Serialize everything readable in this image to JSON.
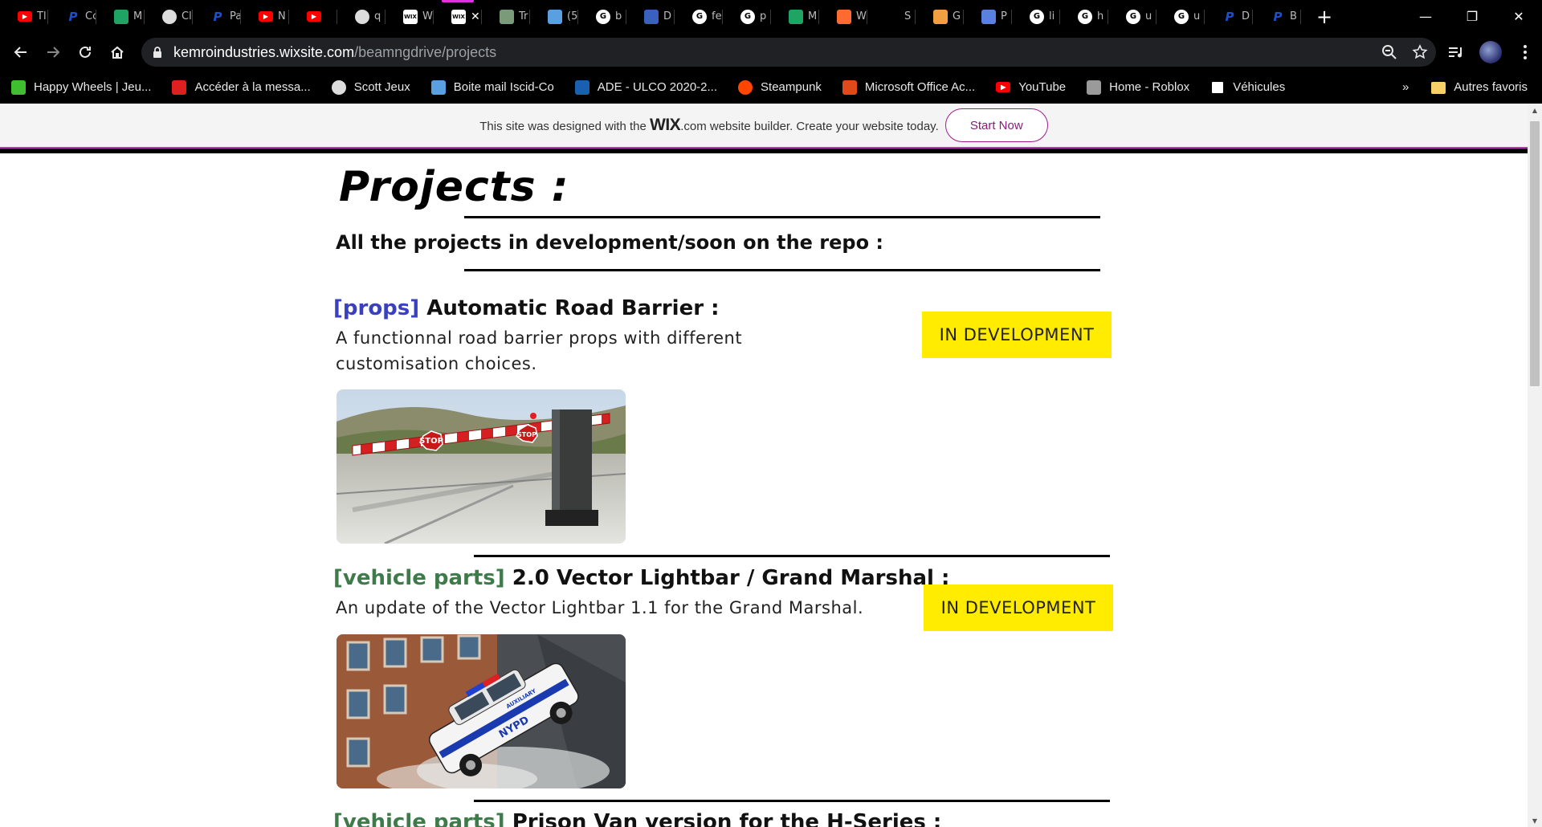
{
  "browser": {
    "tabs": [
      {
        "label": "Tl",
        "icon": "youtube-icon",
        "color": "#ff0000"
      },
      {
        "label": "Cc",
        "icon": "paypal-icon",
        "color": "#1a4fd0"
      },
      {
        "label": "M",
        "icon": "drive-icon",
        "color": "#1fa463"
      },
      {
        "label": "Cl",
        "icon": "globe-icon",
        "color": "#dddddd"
      },
      {
        "label": "Pa",
        "icon": "paypal-icon",
        "color": "#1a4fd0"
      },
      {
        "label": "N",
        "icon": "youtube-icon",
        "color": "#ff0000"
      },
      {
        "label": "",
        "icon": "youtube-audio-icon",
        "color": "#ff0000"
      },
      {
        "label": "q",
        "icon": "globe-icon",
        "color": "#dddddd"
      },
      {
        "label": "W",
        "icon": "wix-icon",
        "color": "#ffffff"
      },
      {
        "label": "",
        "icon": "wix-icon",
        "color": "#ffffff",
        "active": true
      },
      {
        "label": "Tr",
        "icon": "image-icon",
        "color": "#7a9a7a"
      },
      {
        "label": "(5",
        "icon": "chat-icon",
        "color": "#5aa0e0"
      },
      {
        "label": "b",
        "icon": "google-icon",
        "color": "#ffffff"
      },
      {
        "label": "D",
        "icon": "cube-icon",
        "color": "#3a60c0"
      },
      {
        "label": "fe",
        "icon": "google-icon",
        "color": "#ffffff"
      },
      {
        "label": "p",
        "icon": "google-icon",
        "color": "#ffffff"
      },
      {
        "label": "M",
        "icon": "drive-icon",
        "color": "#1fa463"
      },
      {
        "label": "W",
        "icon": "dots-icon",
        "color": "#ff6a30"
      },
      {
        "label": "S",
        "icon": "blank-icon",
        "color": "#000000"
      },
      {
        "label": "G",
        "icon": "pizza-icon",
        "color": "#f0a040"
      },
      {
        "label": "P",
        "icon": "doc-icon",
        "color": "#5a80e0"
      },
      {
        "label": "li",
        "icon": "google-icon",
        "color": "#ffffff"
      },
      {
        "label": "h",
        "icon": "google-icon",
        "color": "#ffffff"
      },
      {
        "label": "u",
        "icon": "google-icon",
        "color": "#ffffff"
      },
      {
        "label": "u",
        "icon": "google-icon",
        "color": "#ffffff"
      },
      {
        "label": "D",
        "icon": "paypal-icon",
        "color": "#1a4fd0"
      },
      {
        "label": "B",
        "icon": "paypal-icon",
        "color": "#1a4fd0"
      }
    ],
    "new_tab": "+",
    "window": {
      "minimize": "—",
      "restore": "❐",
      "close": "✕"
    },
    "url_host": "kemroindustries.wixsite.com",
    "url_path": "/beamngdrive/projects",
    "bookmarks": [
      {
        "label": "Happy Wheels | Jeu...",
        "icon": "happywheels-icon",
        "color": "#3fbf2f"
      },
      {
        "label": "Accéder à la messa...",
        "icon": "mail-smile-icon",
        "color": "#e02020"
      },
      {
        "label": "Scott Jeux",
        "icon": "globe-icon",
        "color": "#dddddd"
      },
      {
        "label": "Boite mail Iscid-Co",
        "icon": "chat-icon",
        "color": "#5aa0e0"
      },
      {
        "label": "ADE - ULCO 2020-2...",
        "icon": "ulco-icon",
        "color": "#1a5fb0"
      },
      {
        "label": "Steampunk",
        "icon": "reddit-icon",
        "color": "#ff4500"
      },
      {
        "label": "Microsoft Office Ac...",
        "icon": "office-icon",
        "color": "#e04a1a"
      },
      {
        "label": "YouTube",
        "icon": "youtube-icon",
        "color": "#ff0000"
      },
      {
        "label": "Home - Roblox",
        "icon": "roblox-icon",
        "color": "#9a9a9a"
      },
      {
        "label": "Véhicules",
        "icon": "vehicle-icon",
        "color": "#ffffff"
      }
    ],
    "bookmarks_overflow": "»",
    "other_bookmarks": "Autres favoris"
  },
  "wix_banner": {
    "text_before": "This site was designed with the ",
    "logo": "WIX",
    "text_after": ".com website builder. Create your website today.",
    "button": "Start Now"
  },
  "page": {
    "title": "Projects :",
    "subtitle": "All the projects in development/soon on the repo :",
    "projects": [
      {
        "tag": "[props]",
        "name": "Automatic Road Barrier :",
        "description": "A functionnal road barrier props with different customisation choices.",
        "status": "IN DEVELOPMENT"
      },
      {
        "tag": "[vehicle parts]",
        "name": "2.0 Vector Lightbar / Grand Marshal :",
        "description": "An update of the Vector Lightbar 1.1 for the Grand Marshal.",
        "status": "IN DEVELOPMENT"
      },
      {
        "tag": "[vehicle parts]",
        "name": "Prison Van version for the H-Series :"
      }
    ]
  },
  "image_text": {
    "stop_sign_1": "STOP",
    "stop_sign_2": "STOP",
    "car_door": "NYPD",
    "car_hood": "AUXILIARY"
  },
  "colors": {
    "tag_props": "#3a40c0",
    "tag_vehicle": "#3f7a4a",
    "status_bg": "#ffec00",
    "wix_accent": "#a01c8c"
  }
}
